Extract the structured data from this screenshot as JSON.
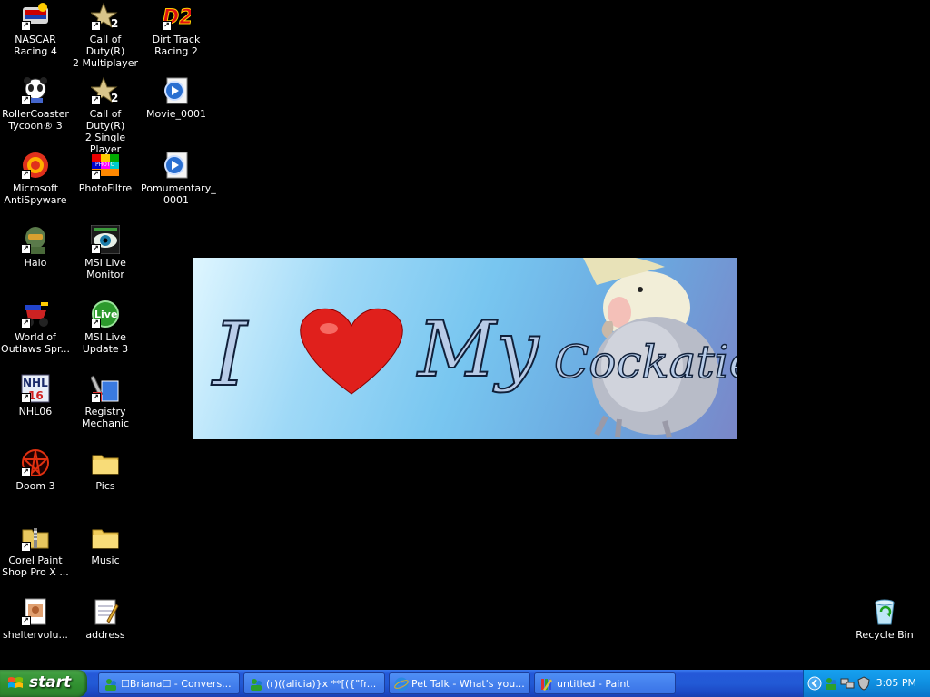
{
  "desktop": {
    "icons": [
      {
        "label": "NASCAR\nRacing 4"
      },
      {
        "label": "Call of Duty(R)\n2 Multiplayer"
      },
      {
        "label": "Dirt Track\nRacing 2"
      },
      {
        "label": "RollerCoaster\nTycoon® 3"
      },
      {
        "label": "Call of Duty(R)\n2 Single Player"
      },
      {
        "label": "Movie_0001"
      },
      {
        "label": "Microsoft\nAntiSpyware"
      },
      {
        "label": "PhotoFiltre"
      },
      {
        "label": "Pomumentary_\n0001"
      },
      {
        "label": "Halo"
      },
      {
        "label": "MSI Live\nMonitor"
      },
      {
        "label": "World of\nOutlaws Spr..."
      },
      {
        "label": "MSI Live\nUpdate 3"
      },
      {
        "label": "NHL06"
      },
      {
        "label": "Registry\nMechanic"
      },
      {
        "label": "Doom 3"
      },
      {
        "label": "Pics"
      },
      {
        "label": "Corel Paint\nShop Pro X ..."
      },
      {
        "label": "Music"
      },
      {
        "label": "sheltervolu..."
      },
      {
        "label": "address"
      },
      {
        "label": "Recycle Bin"
      }
    ],
    "icon_glyphs": {
      "nhl": "NHL",
      "nhl_num": "16",
      "msi_live": "Live",
      "cod_num": "2",
      "dirt_track": "D2",
      "photofiltre": "PHOTO"
    }
  },
  "wallpaper_banner": {
    "word_i": "I",
    "word_my": "My",
    "word_cockatiel": "Cockatiel",
    "heart_color": "#e0201c"
  },
  "taskbar": {
    "start_label": "start",
    "tasks": [
      {
        "label": "☐Briana☐ - Convers..."
      },
      {
        "label": "(r)((alicia)}x **[({\"fr..."
      },
      {
        "label": "Pet Talk - What's you..."
      },
      {
        "label": "untitled - Paint"
      }
    ],
    "clock": "3:05 PM"
  },
  "colors": {
    "taskbar_blue": "#225ad6",
    "start_green": "#3c9a3c",
    "tray_blue": "#0f8fe0"
  }
}
